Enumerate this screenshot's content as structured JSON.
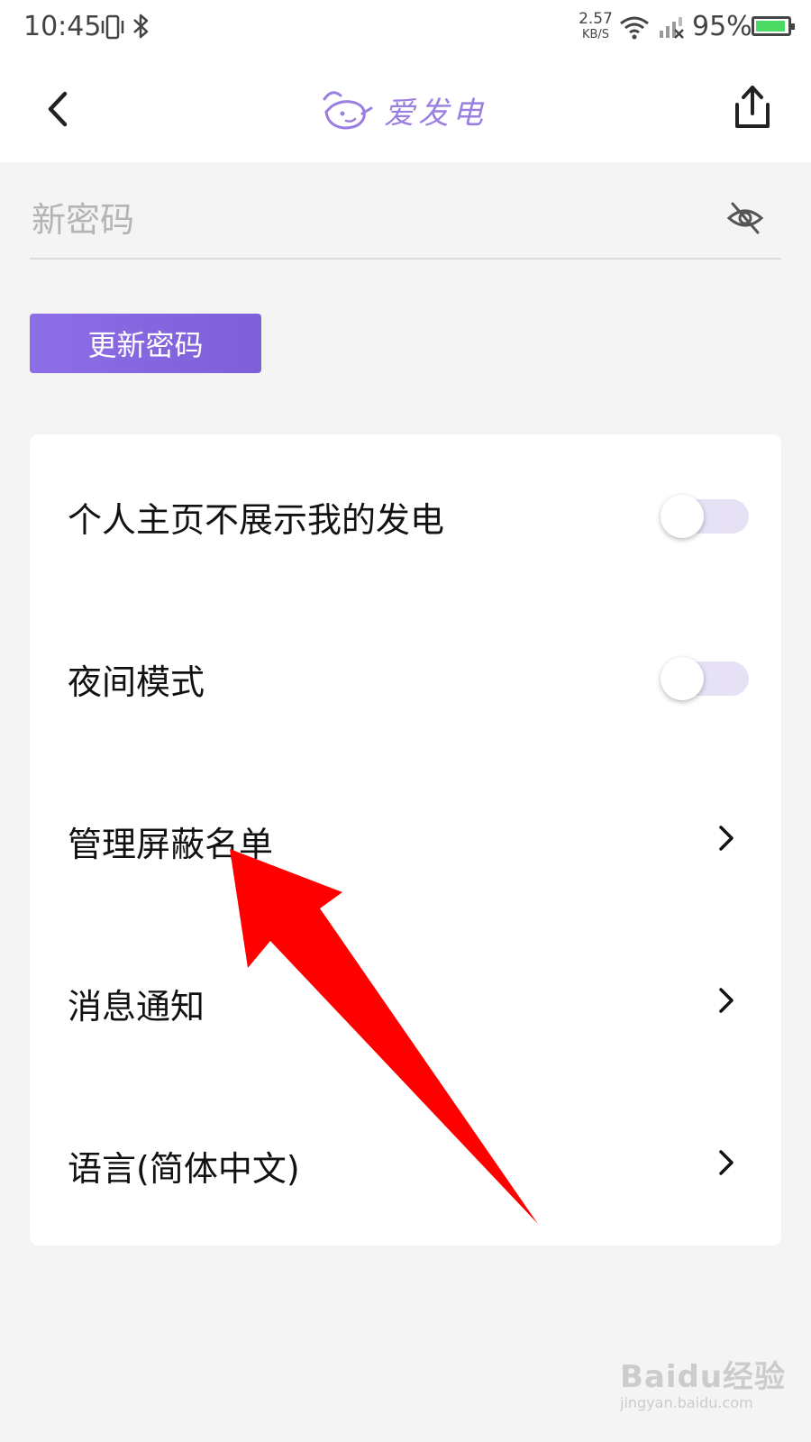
{
  "status_bar": {
    "time": "10:45",
    "net_speed_value": "2.57",
    "net_speed_unit": "KB/S",
    "battery_percent": "95%",
    "battery_level": 0.95,
    "icons": [
      "vibrate-icon",
      "bluetooth-icon",
      "wifi-icon",
      "cell-signal-icon",
      "battery-icon"
    ]
  },
  "header": {
    "title": "爱发电",
    "back_icon": "chevron-left-icon",
    "share_icon": "share-icon"
  },
  "password": {
    "placeholder": "新密码",
    "value": "",
    "visibility_icon": "eye-off-icon"
  },
  "update_button": {
    "label": "更新密码"
  },
  "settings": {
    "items": [
      {
        "label": "个人主页不展示我的发电",
        "control": "toggle",
        "on": false
      },
      {
        "label": "夜间模式",
        "control": "toggle",
        "on": false
      },
      {
        "label": "管理屏蔽名单",
        "control": "chevron"
      },
      {
        "label": "消息通知",
        "control": "chevron"
      },
      {
        "label": "语言(简体中文)",
        "control": "chevron"
      }
    ]
  },
  "colors": {
    "accent": "#8d6ee6",
    "toggle_track": "#e6e1f5",
    "annotation_arrow": "#ff0000",
    "background": "#f4f4f4"
  },
  "watermark": {
    "brand": "Baidu经验",
    "url": "jingyan.baidu.com"
  }
}
